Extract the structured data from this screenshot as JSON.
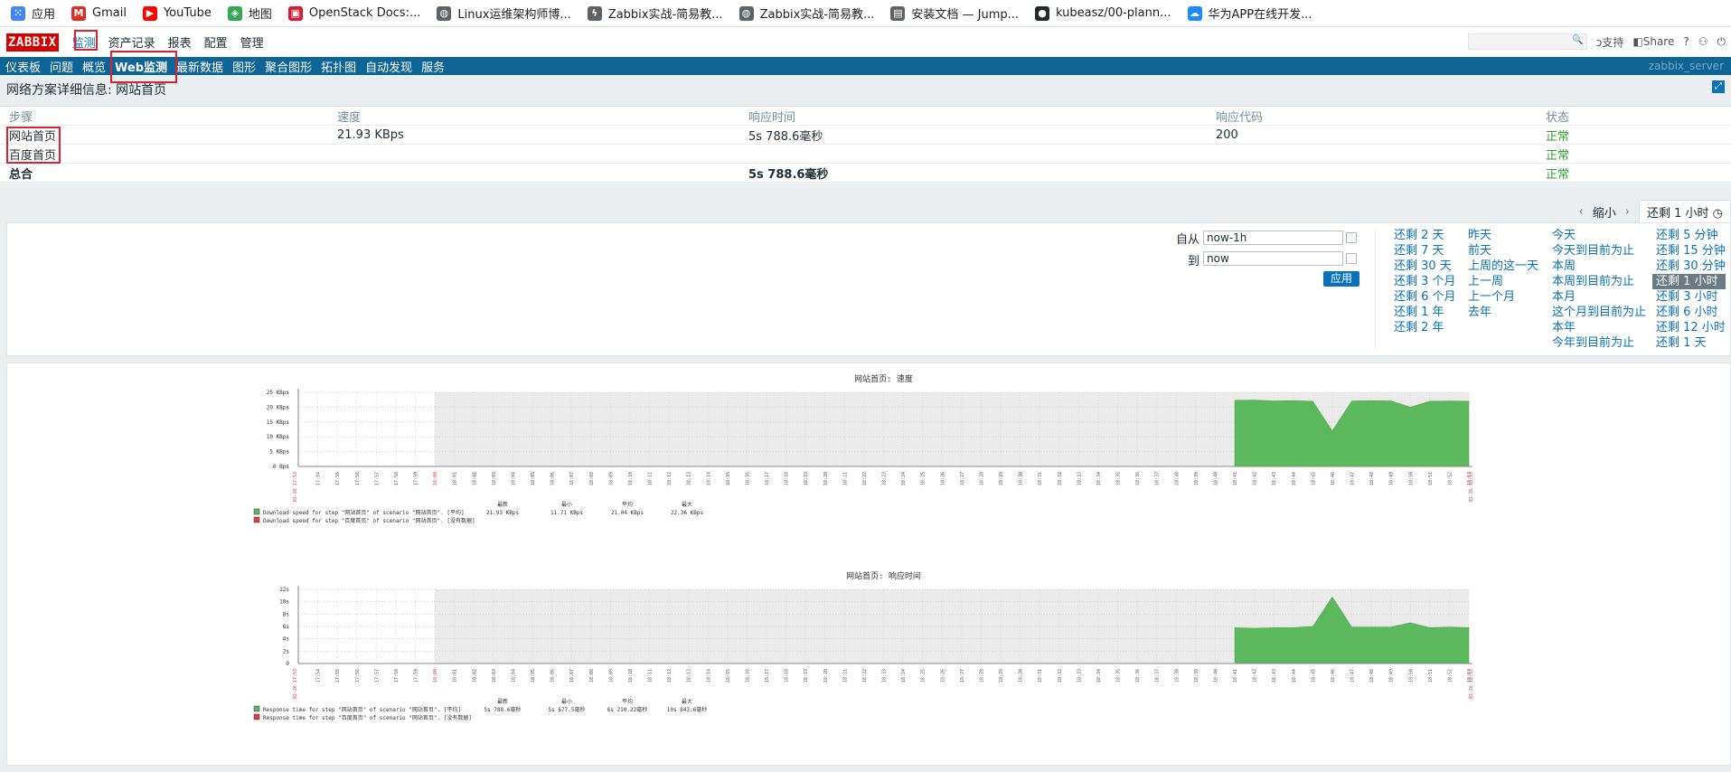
{
  "bookmarks": [
    {
      "label": "应用",
      "icon": "apps-grid-icon",
      "color": "#4285f4"
    },
    {
      "label": "Gmail",
      "icon": "gmail-icon",
      "color": "#d93025"
    },
    {
      "label": "YouTube",
      "icon": "youtube-icon",
      "color": "#ff0000"
    },
    {
      "label": "地图",
      "icon": "maps-icon",
      "color": "#34a853"
    },
    {
      "label": "OpenStack Docs:...",
      "icon": "openstack-icon",
      "color": "#da1a32"
    },
    {
      "label": "Linux运维架构师博...",
      "icon": "globe-icon",
      "color": "#5f6368"
    },
    {
      "label": "Zabbix实战-简易教...",
      "icon": "zabbix-icon",
      "color": "#5f6368"
    },
    {
      "label": "Zabbix实战-简易教...",
      "icon": "globe-icon",
      "color": "#5f6368"
    },
    {
      "label": "安装文档 — Jump...",
      "icon": "doc-icon",
      "color": "#5f6368"
    },
    {
      "label": "kubeasz/00-plann...",
      "icon": "github-icon",
      "color": "#24292e"
    },
    {
      "label": "华为APP在线开发...",
      "icon": "cloud-icon",
      "color": "#1a8cff"
    }
  ],
  "topnav": {
    "logo": "ZABBIX",
    "menu": [
      "监测",
      "资产记录",
      "报表",
      "配置",
      "管理"
    ],
    "active_index": 0,
    "support": "支持",
    "share": "Share",
    "help": "?",
    "profile": "⚇",
    "logout": "⏻"
  },
  "subnav": {
    "items": [
      "仪表板",
      "问题",
      "概览",
      "Web监测",
      "最新数据",
      "图形",
      "聚合图形",
      "拓扑图",
      "自动发现",
      "服务"
    ],
    "active_index": 3,
    "server": "zabbix_server"
  },
  "page_title": "网络方案详细信息: 网站首页",
  "steps": {
    "headers": [
      "步骤",
      "速度",
      "响应时间",
      "响应代码",
      "状态"
    ],
    "rows": [
      [
        "网站首页",
        "21.93 KBps",
        "5s 788.6毫秒",
        "200",
        "正常"
      ],
      [
        "百度首页",
        "",
        "",
        "",
        "正常"
      ]
    ],
    "total": [
      "总合",
      "",
      "5s 788.6毫秒",
      "",
      "正常"
    ]
  },
  "filter": {
    "zoom_out": "缩小",
    "current_tab": "还剩 1 小时",
    "from_label": "自从",
    "from_value": "now-1h",
    "to_label": "到",
    "to_value": "now",
    "apply": "应用",
    "quick_cols": [
      [
        "还剩 2 天",
        "还剩 7 天",
        "还剩 30 天",
        "还剩 3 个月",
        "还剩 6 个月",
        "还剩 1 年",
        "还剩 2 年"
      ],
      [
        "昨天",
        "前天",
        "上周的这一天",
        "上一周",
        "上一个月",
        "去年"
      ],
      [
        "今天",
        "今天到目前为止",
        "本周",
        "本周到目前为止",
        "本月",
        "这个月到目前为止",
        "本年",
        "今年到目前为止"
      ],
      [
        "还剩 5 分钟",
        "还剩 15 分钟",
        "还剩 30 分钟",
        "还剩 1 小时",
        "还剩 3 小时",
        "还剩 6 小时",
        "还剩 12 小时",
        "还剩 1 天"
      ]
    ],
    "selected": "还剩 1 小时"
  },
  "colors": {
    "fill": "#5cb85c",
    "legend_red": "#e04040",
    "bg_grey": "#ebebeb"
  },
  "chart_data": [
    {
      "type": "area",
      "title": "网站首页: 速度",
      "ylim": [
        0,
        25
      ],
      "yticks": [
        "0 Bps",
        "5 KBps",
        "10 KBps",
        "15 KBps",
        "20 KBps",
        "25 KBps"
      ],
      "start_label": "02-26 17:53",
      "end_label": "02-26 18:53",
      "xticks": [
        "17:54",
        "17:55",
        "17:56",
        "17:57",
        "17:58",
        "17:59",
        "18:00",
        "18:01",
        "18:02",
        "18:03",
        "18:04",
        "18:05",
        "18:06",
        "18:07",
        "18:08",
        "18:09",
        "18:10",
        "18:11",
        "18:12",
        "18:13",
        "18:14",
        "18:15",
        "18:16",
        "18:17",
        "18:18",
        "18:19",
        "18:20",
        "18:21",
        "18:22",
        "18:23",
        "18:24",
        "18:25",
        "18:26",
        "18:27",
        "18:28",
        "18:29",
        "18:30",
        "18:31",
        "18:32",
        "18:33",
        "18:34",
        "18:35",
        "18:36",
        "18:37",
        "18:38",
        "18:39",
        "18:40",
        "18:41",
        "18:42",
        "18:43",
        "18:44",
        "18:45",
        "18:46",
        "18:47",
        "18:48",
        "18:49",
        "18:50",
        "18:51",
        "18:52",
        "18:53"
      ],
      "series": [
        {
          "x": [
            "18:41",
            "18:42",
            "18:43",
            "18:44",
            "18:45",
            "18:46",
            "18:47",
            "18:48",
            "18:49",
            "18:50",
            "18:51",
            "18:52",
            "18:53"
          ],
          "values": [
            22.3,
            22.4,
            22.1,
            22.2,
            22.0,
            12.0,
            22.1,
            22.2,
            22.1,
            20.0,
            22.0,
            22.1,
            22.0
          ]
        }
      ],
      "legend": [
        {
          "text": "Download speed for step \"网站首页\" of scenario \"网站首页\".  [平均]",
          "last": "21.93 KBps",
          "min": "11.71 KBps",
          "avg": "21.04 KBps",
          "max": "22.36 KBps"
        },
        {
          "text": "Download speed for step \"百度首页\" of scenario \"网站首页\".  [没有数据]",
          "last": "",
          "min": "",
          "avg": "",
          "max": ""
        }
      ],
      "stat_headers": [
        "最新",
        "最小",
        "平均",
        "最大"
      ]
    },
    {
      "type": "area",
      "title": "网站首页: 响应时间",
      "ylim": [
        0,
        12
      ],
      "yticks": [
        "0",
        "2s",
        "4s",
        "6s",
        "8s",
        "10s",
        "12s"
      ],
      "start_label": "02-26 17:53",
      "end_label": "02-26 18:53",
      "xticks": [
        "17:54",
        "17:55",
        "17:56",
        "17:57",
        "17:58",
        "17:59",
        "18:00",
        "18:01",
        "18:02",
        "18:03",
        "18:04",
        "18:05",
        "18:06",
        "18:07",
        "18:08",
        "18:09",
        "18:10",
        "18:11",
        "18:12",
        "18:13",
        "18:14",
        "18:15",
        "18:16",
        "18:17",
        "18:18",
        "18:19",
        "18:20",
        "18:21",
        "18:22",
        "18:23",
        "18:24",
        "18:25",
        "18:26",
        "18:27",
        "18:28",
        "18:29",
        "18:30",
        "18:31",
        "18:32",
        "18:33",
        "18:34",
        "18:35",
        "18:36",
        "18:37",
        "18:38",
        "18:39",
        "18:40",
        "18:41",
        "18:42",
        "18:43",
        "18:44",
        "18:45",
        "18:46",
        "18:47",
        "18:48",
        "18:49",
        "18:50",
        "18:51",
        "18:52",
        "18:53"
      ],
      "series": [
        {
          "x": [
            "18:41",
            "18:42",
            "18:43",
            "18:44",
            "18:45",
            "18:46",
            "18:47",
            "18:48",
            "18:49",
            "18:50",
            "18:51",
            "18:52",
            "18:53"
          ],
          "values": [
            5.8,
            5.7,
            5.8,
            5.8,
            6.0,
            10.8,
            5.9,
            5.9,
            5.9,
            6.6,
            5.8,
            5.9,
            5.8
          ]
        }
      ],
      "legend": [
        {
          "text": "Response time for step \"网站首页\" of scenario \"网站首页\".  [平均]",
          "last": "5s 788.6毫秒",
          "min": "5s 677.5毫秒",
          "avg": "6s 210.22毫秒",
          "max": "10s 843.6毫秒"
        },
        {
          "text": "Response time for step \"百度首页\" of scenario \"网站首页\".  [没有数据]",
          "last": "",
          "min": "",
          "avg": "",
          "max": ""
        }
      ],
      "stat_headers": [
        "最新",
        "最小",
        "平均",
        "最大"
      ]
    }
  ]
}
